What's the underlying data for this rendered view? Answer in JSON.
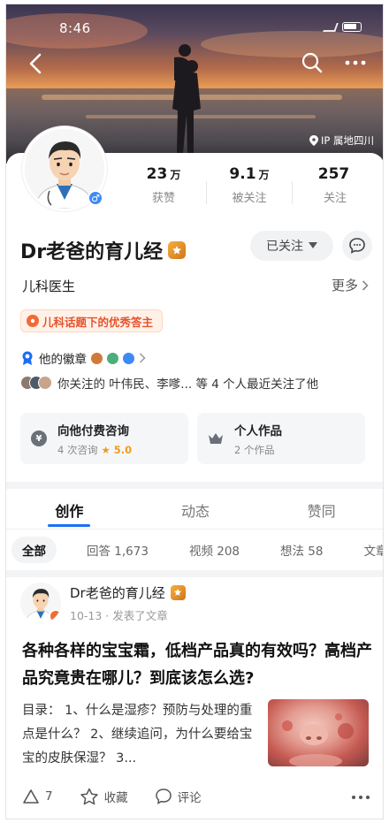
{
  "status_bar": {
    "time": "8:46"
  },
  "header": {
    "ip_location": "IP 属地四川"
  },
  "profile": {
    "name": "Dr老爸的育儿经",
    "role": "儿科医生",
    "more_label": "更多",
    "follow_button": "已关注",
    "honor_badge": "儿科话题下的优秀答主",
    "medals_label": "他的徽章",
    "mutual_follow_text": "你关注的 叶伟民、李嗲... 等 4 个人最近关注了他",
    "stats": [
      {
        "value": "23",
        "unit": "万",
        "label": "获赞"
      },
      {
        "value": "9.1",
        "unit": "万",
        "label": "被关注"
      },
      {
        "value": "257",
        "unit": "",
        "label": "关注"
      }
    ],
    "services": [
      {
        "title": "向他付费咨询",
        "sub_prefix": "4 次咨询",
        "rating": "★ 5.0"
      },
      {
        "title": "个人作品",
        "sub_prefix": "2 个作品",
        "rating": ""
      }
    ]
  },
  "tabs": [
    {
      "label": "创作",
      "active": true
    },
    {
      "label": "动态",
      "active": false
    },
    {
      "label": "赞同",
      "active": false
    }
  ],
  "filters": [
    {
      "label": "全部",
      "active": true
    },
    {
      "label": "回答 1,673",
      "active": false
    },
    {
      "label": "视频 208",
      "active": false
    },
    {
      "label": "想法 58",
      "active": false
    },
    {
      "label": "文章",
      "active": false
    }
  ],
  "post": {
    "author": "Dr老爸的育儿经",
    "meta": "10-13 · 发表了文章",
    "title": "各种各样的宝宝霜，低档产品真的有效吗？高档产品究竟贵在哪儿？到底该怎么选?",
    "excerpt": "目录： 1、什么是湿疹？预防与处理的重点是什么？ 2、继续追问，为什么要给宝宝的皮肤保湿？ 3...",
    "likes": "7",
    "collect_label": "收藏",
    "comment_label": "评论"
  },
  "colors": {
    "accent": "#1a6ef5",
    "honor": "#e5532b",
    "rating": "#f39a1c"
  }
}
